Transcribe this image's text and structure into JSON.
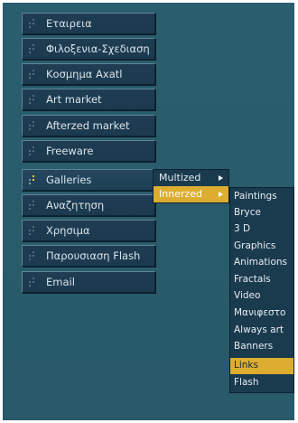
{
  "menu": {
    "items": [
      {
        "label": "Εταιρεια"
      },
      {
        "label": "Φιλοξενια-Σχεδιαση"
      },
      {
        "label": "Κοσμημα Axatl"
      },
      {
        "label": "Art market"
      },
      {
        "label": "Afterzed market"
      },
      {
        "label": "Freeware"
      },
      {
        "label": "Galleries"
      },
      {
        "label": "Αναζητηση"
      },
      {
        "label": "Χρησιμα"
      },
      {
        "label": "Παρουσιαση Flash"
      },
      {
        "label": "Email"
      }
    ],
    "active_index": 6
  },
  "submenu": {
    "items": [
      {
        "label": "Multized"
      },
      {
        "label": "Innerzed"
      }
    ],
    "highlighted_index": 1
  },
  "submenu2": {
    "items": [
      {
        "label": "Paintings"
      },
      {
        "label": "Bryce"
      },
      {
        "label": "3 D"
      },
      {
        "label": "Graphics"
      },
      {
        "label": "Animations"
      },
      {
        "label": "Fractals"
      },
      {
        "label": "Video"
      },
      {
        "label": "Μανιφεστο"
      },
      {
        "label": "Always art"
      },
      {
        "label": "Banners"
      },
      {
        "label": "Links"
      },
      {
        "label": "Flash"
      }
    ],
    "highlighted_index": 10
  },
  "colors": {
    "background": "#295c6b",
    "button": "#1b3a4f",
    "highlight": "#dcad2f",
    "text": "#d9e3ea"
  }
}
